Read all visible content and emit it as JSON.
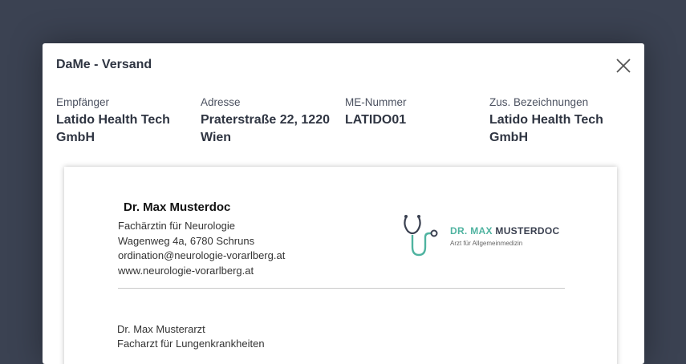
{
  "dialog": {
    "title": "DaMe - Versand"
  },
  "fields": [
    {
      "label": "Empfänger",
      "value": "Latido Health Tech GmbH"
    },
    {
      "label": "Adresse",
      "value": "Praterstraße 22, 1220 Wien"
    },
    {
      "label": "ME-Nummer",
      "value": "LATIDO01"
    },
    {
      "label": "Zus. Bezeichnungen",
      "value": "Latido Health Tech GmbH"
    }
  ],
  "letter": {
    "sender_name": "Dr. Max Musterdoc",
    "sender_lines": [
      "Fachärztin für Neurologie",
      "Wagenweg 4a, 6780 Schruns",
      "ordination@neurologie-vorarlberg.at",
      "www.neurologie-vorarlberg.at"
    ],
    "logo": {
      "title_highlight": "DR. MAX",
      "title_rest": "MUSTERDOC",
      "subtitle": "Arzt für Allgemeinmedizin",
      "icon": "stethoscope-icon"
    },
    "recipient_lines": [
      "Dr. Max Musterarzt",
      "Facharzt für Lungenkrankheiten"
    ]
  },
  "colors": {
    "backdrop": "#3b4252",
    "accent": "#4fb3a0",
    "text": "#2f3542"
  }
}
